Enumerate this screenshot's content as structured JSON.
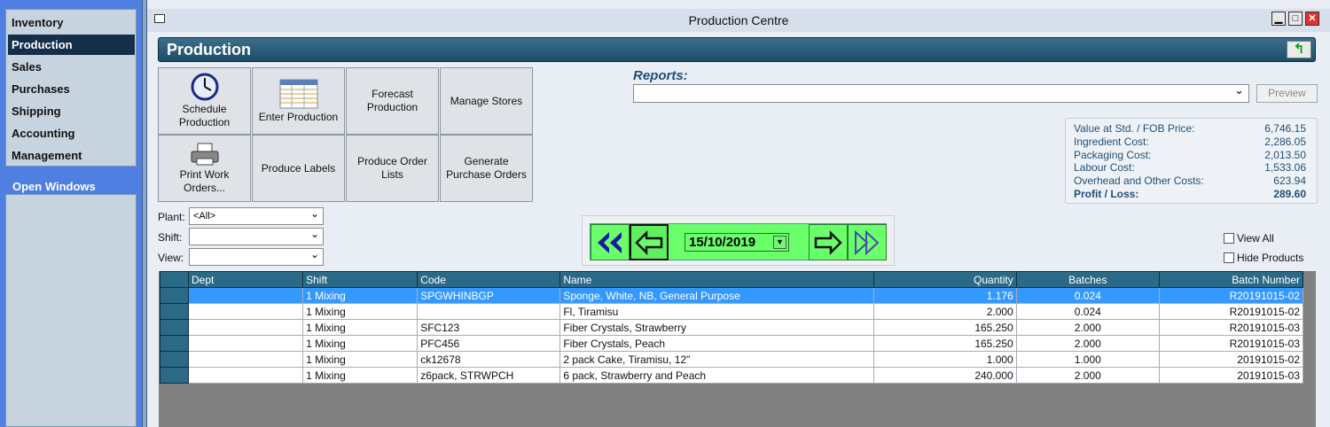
{
  "sidebar": {
    "items": [
      {
        "label": "Inventory"
      },
      {
        "label": "Production"
      },
      {
        "label": "Sales"
      },
      {
        "label": "Purchases"
      },
      {
        "label": "Shipping"
      },
      {
        "label": "Accounting"
      },
      {
        "label": "Management"
      }
    ],
    "selected": "Production",
    "open_windows_title": "Open Windows"
  },
  "window": {
    "title": "Production Centre",
    "min": "▁",
    "max": "□",
    "close": "✕"
  },
  "page": {
    "title": "Production",
    "exit_icon": "green-exit-arrow"
  },
  "tiles": [
    {
      "label": "Schedule Production",
      "icon": "clock-icon"
    },
    {
      "label": "Enter Production",
      "icon": "spreadsheet-icon"
    },
    {
      "label": "Forecast Production"
    },
    {
      "label": "Manage Stores"
    },
    {
      "label": "Print Work Orders...",
      "icon": "printer-icon"
    },
    {
      "label": "Produce Labels"
    },
    {
      "label": "Produce Order Lists"
    },
    {
      "label": "Generate Purchase Orders"
    }
  ],
  "filters": {
    "plant_label": "Plant:",
    "plant_value": "<All>",
    "shift_label": "Shift:",
    "shift_value": "",
    "view_label": "View:",
    "view_value": ""
  },
  "reports": {
    "label": "Reports:",
    "value": "",
    "preview": "Preview"
  },
  "summary": [
    {
      "label": "Value at Std. / FOB Price:",
      "value": "6,746.15"
    },
    {
      "label": "Ingredient Cost:",
      "value": "2,286.05"
    },
    {
      "label": "Packaging Cost:",
      "value": "2,013.50"
    },
    {
      "label": "Labour Cost:",
      "value": "1,533.06"
    },
    {
      "label": "Overhead and Other Costs:",
      "value": "623.94"
    },
    {
      "label": "Profit / Loss:",
      "value": "289.60"
    }
  ],
  "date_nav": {
    "date": "15/10/2019",
    "active_button": "back"
  },
  "options": {
    "view_all": "View All",
    "hide_products": "Hide Products"
  },
  "grid": {
    "columns": [
      "Dept",
      "Shift",
      "Code",
      "Name",
      "Quantity",
      "Batches",
      "Batch Number"
    ],
    "rows": [
      [
        "",
        "1 Mixing",
        "SPGWHINBGP",
        "Sponge, White, NB, General Purpose",
        "1.176",
        "0.024",
        "R20191015-02"
      ],
      [
        "",
        "1 Mixing",
        "",
        "Fl, Tiramisu",
        "2.000",
        "0.024",
        "R20191015-02"
      ],
      [
        "",
        "1 Mixing",
        "SFC123",
        "Fiber Crystals, Strawberry",
        "165.250",
        "2.000",
        "R20191015-03"
      ],
      [
        "",
        "1 Mixing",
        "PFC456",
        "Fiber Crystals, Peach",
        "165.250",
        "2.000",
        "R20191015-03"
      ],
      [
        "",
        "1 Mixing",
        "ck12678",
        "2 pack Cake, Tiramisu, 12\"",
        "1.000",
        "1.000",
        "20191015-02"
      ],
      [
        "",
        "1 Mixing",
        "z6pack, STRWPCH",
        "6 pack, Strawberry and Peach",
        "240.000",
        "2.000",
        "20191015-03"
      ]
    ],
    "selected_row": 0
  },
  "colors": {
    "header": "#2b6a87",
    "selection": "#3399ff",
    "date_bar": "#6aff6a"
  }
}
